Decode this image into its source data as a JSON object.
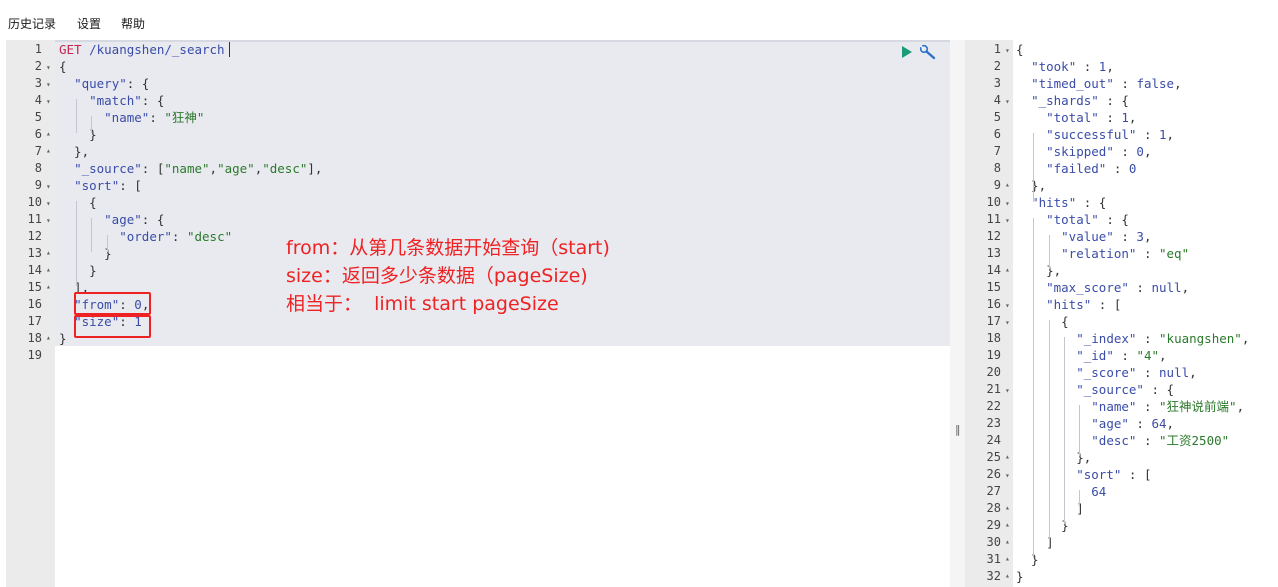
{
  "menu": {
    "history": "历史记录",
    "settings": "设置",
    "help": "帮助"
  },
  "request": {
    "lines": [
      {
        "n": "1",
        "t": "GET /kuangshen/_search",
        "type": "method"
      },
      {
        "n": "2",
        "t": "{",
        "fold": "down"
      },
      {
        "n": "3",
        "t": "  \"query\": {",
        "fold": "down"
      },
      {
        "n": "4",
        "t": "    \"match\": {",
        "fold": "down"
      },
      {
        "n": "5",
        "t": "      \"name\": \"狂神\""
      },
      {
        "n": "6",
        "t": "    }",
        "fold": "up"
      },
      {
        "n": "7",
        "t": "  },",
        "fold": "up"
      },
      {
        "n": "8",
        "t": "  \"_source\": [\"name\",\"age\",\"desc\"],"
      },
      {
        "n": "9",
        "t": "  \"sort\": [",
        "fold": "down"
      },
      {
        "n": "10",
        "t": "    {",
        "fold": "down"
      },
      {
        "n": "11",
        "t": "      \"age\": {",
        "fold": "down"
      },
      {
        "n": "12",
        "t": "        \"order\": \"desc\""
      },
      {
        "n": "13",
        "t": "      }",
        "fold": "up"
      },
      {
        "n": "14",
        "t": "    }",
        "fold": "up"
      },
      {
        "n": "15",
        "t": "  ],",
        "fold": "up"
      },
      {
        "n": "16",
        "t": "  \"from\": 0,"
      },
      {
        "n": "17",
        "t": "  \"size\": 1"
      },
      {
        "n": "18",
        "t": "}",
        "fold": "up"
      },
      {
        "n": "19",
        "t": ""
      }
    ]
  },
  "annotation": {
    "line1": "from：从第几条数据开始查询（start)",
    "line2": "size：返回多少条数据（pageSize)",
    "line3": "相当于：  limit start pageSize"
  },
  "response": {
    "lines": [
      {
        "n": "1",
        "t": "{",
        "fold": "down"
      },
      {
        "n": "2",
        "t": "  \"took\" : 1,"
      },
      {
        "n": "3",
        "t": "  \"timed_out\" : false,"
      },
      {
        "n": "4",
        "t": "  \"_shards\" : {",
        "fold": "down"
      },
      {
        "n": "5",
        "t": "    \"total\" : 1,"
      },
      {
        "n": "6",
        "t": "    \"successful\" : 1,"
      },
      {
        "n": "7",
        "t": "    \"skipped\" : 0,"
      },
      {
        "n": "8",
        "t": "    \"failed\" : 0"
      },
      {
        "n": "9",
        "t": "  },",
        "fold": "up"
      },
      {
        "n": "10",
        "t": "  \"hits\" : {",
        "fold": "down"
      },
      {
        "n": "11",
        "t": "    \"total\" : {",
        "fold": "down"
      },
      {
        "n": "12",
        "t": "      \"value\" : 3,"
      },
      {
        "n": "13",
        "t": "      \"relation\" : \"eq\""
      },
      {
        "n": "14",
        "t": "    },",
        "fold": "up"
      },
      {
        "n": "15",
        "t": "    \"max_score\" : null,"
      },
      {
        "n": "16",
        "t": "    \"hits\" : [",
        "fold": "down"
      },
      {
        "n": "17",
        "t": "      {",
        "fold": "down"
      },
      {
        "n": "18",
        "t": "        \"_index\" : \"kuangshen\","
      },
      {
        "n": "19",
        "t": "        \"_id\" : \"4\","
      },
      {
        "n": "20",
        "t": "        \"_score\" : null,"
      },
      {
        "n": "21",
        "t": "        \"_source\" : {",
        "fold": "down"
      },
      {
        "n": "22",
        "t": "          \"name\" : \"狂神说前端\","
      },
      {
        "n": "23",
        "t": "          \"age\" : 64,"
      },
      {
        "n": "24",
        "t": "          \"desc\" : \"工资2500\""
      },
      {
        "n": "25",
        "t": "        },",
        "fold": "up"
      },
      {
        "n": "26",
        "t": "        \"sort\" : [",
        "fold": "down"
      },
      {
        "n": "27",
        "t": "          64"
      },
      {
        "n": "28",
        "t": "        ]",
        "fold": "up"
      },
      {
        "n": "29",
        "t": "      }",
        "fold": "up"
      },
      {
        "n": "30",
        "t": "    ]",
        "fold": "up"
      },
      {
        "n": "31",
        "t": "  }",
        "fold": "up"
      },
      {
        "n": "32",
        "t": "}",
        "fold": "up"
      }
    ]
  },
  "icons": {
    "run": "play-icon",
    "settings": "wrench-icon",
    "splitter": "drag-handle-icon"
  },
  "colors": {
    "annotation": "#ee2222",
    "key": "#3a4ca8",
    "string": "#2b7a2b",
    "method": "#c7254e",
    "run": "#1a9c7a"
  }
}
